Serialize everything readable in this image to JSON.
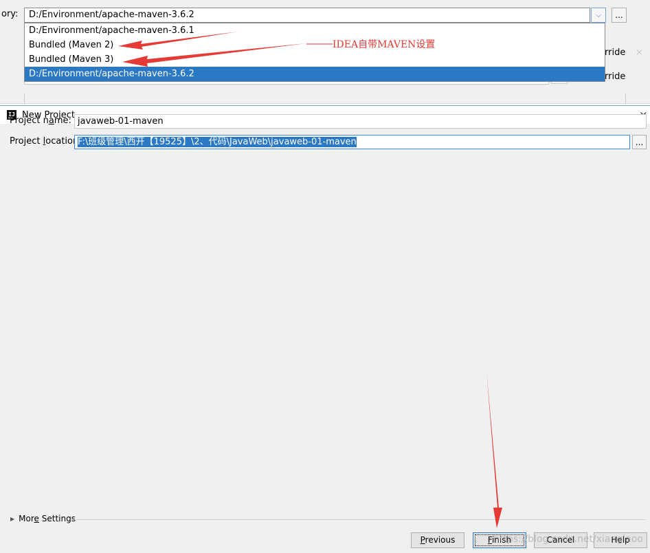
{
  "maven_settings": {
    "label_fragment": "ory:",
    "selected_value": "D:/Environment/apache-maven-3.6.2",
    "browse_label": "...",
    "dropdown_options": [
      "D:/Environment/apache-maven-3.6.1",
      "Bundled (Maven 2)",
      "Bundled (Maven 3)",
      "D:/Environment/apache-maven-3.6.2"
    ],
    "override_labels": [
      "rride",
      "rride"
    ],
    "faint_close": "×"
  },
  "annotation": {
    "text": "IDEA自带MAVEN设置",
    "color": "#e53a35"
  },
  "window": {
    "icon_text": "IJ",
    "title": "New Project",
    "close_glyph": "×"
  },
  "form": {
    "project_name_label": {
      "pre": "Project n",
      "mnemonic": "a",
      "post": "me:"
    },
    "project_name_value": "javaweb-01-maven",
    "project_location_label": {
      "pre": "Project ",
      "mnemonic": "l",
      "post": "ocation:"
    },
    "project_location_value": "F:\\班级管理\\西开【19525】\\2、代码\\JavaWeb\\javaweb-01-maven",
    "browse_label": "..."
  },
  "more_settings": {
    "pre": "Mor",
    "mnemonic": "e",
    "post": " Settings",
    "icon": "triangle-right-icon"
  },
  "buttons": {
    "previous": {
      "mnemonic": "P",
      "rest": "revious"
    },
    "finish": {
      "mnemonic": "F",
      "rest": "inish"
    },
    "cancel": "Cancel",
    "help": "Help"
  },
  "watermark": "https://blog.csdn.net/xianglaoo",
  "colors": {
    "selection": "#2b78c5",
    "focus_border": "#3f8bd8",
    "arrow": "#e53a35"
  }
}
